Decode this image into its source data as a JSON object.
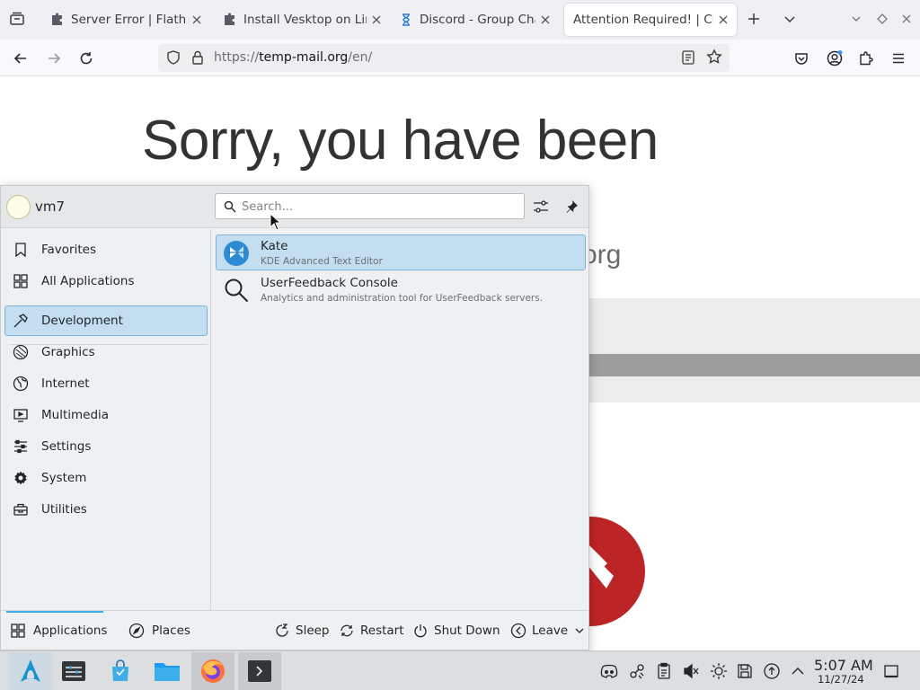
{
  "browser": {
    "tabs": [
      {
        "label": "Server Error | Flathub",
        "favicon": "puzzle-icon"
      },
      {
        "label": "Install Vesktop on Linux",
        "favicon": "puzzle-icon"
      },
      {
        "label": "Discord - Group Chat",
        "favicon": "hourglass-icon"
      },
      {
        "label": "Attention Required! | Cloudflare",
        "favicon": "none",
        "active": true
      }
    ],
    "url_prefix": "https://",
    "url_host": "temp-mail.org",
    "url_path": "/en/"
  },
  "page": {
    "headline": "Sorry, you have been",
    "domain_fragment": "org",
    "error_color": "#bd2426"
  },
  "launcher": {
    "user": "vm7",
    "search_placeholder": "Search...",
    "categories": [
      {
        "label": "Favorites",
        "icon": "bookmark-icon"
      },
      {
        "label": "All Applications",
        "icon": "grid-icon"
      },
      {
        "label": "Development",
        "icon": "hammer-icon",
        "selected": true
      },
      {
        "label": "Graphics",
        "icon": "palette-icon"
      },
      {
        "label": "Internet",
        "icon": "globe-icon"
      },
      {
        "label": "Multimedia",
        "icon": "monitor-play-icon"
      },
      {
        "label": "Settings",
        "icon": "sliders-icon"
      },
      {
        "label": "System",
        "icon": "cog-icon"
      },
      {
        "label": "Utilities",
        "icon": "toolbox-icon"
      }
    ],
    "apps": [
      {
        "name": "Kate",
        "description": "KDE Advanced Text Editor",
        "icon": "kate-icon",
        "selected": true
      },
      {
        "name": "UserFeedback Console",
        "description": "Analytics and administration tool for UserFeedback servers.",
        "icon": "search-icon"
      }
    ],
    "footer": {
      "applications": "Applications",
      "places": "Places",
      "sleep": "Sleep",
      "restart": "Restart",
      "shutdown": "Shut Down",
      "leave": "Leave"
    },
    "accent": "#3daee9",
    "selection_bg": "#c4def1"
  },
  "taskbar": {
    "time": "5:07 AM",
    "date": "11/27/24"
  }
}
